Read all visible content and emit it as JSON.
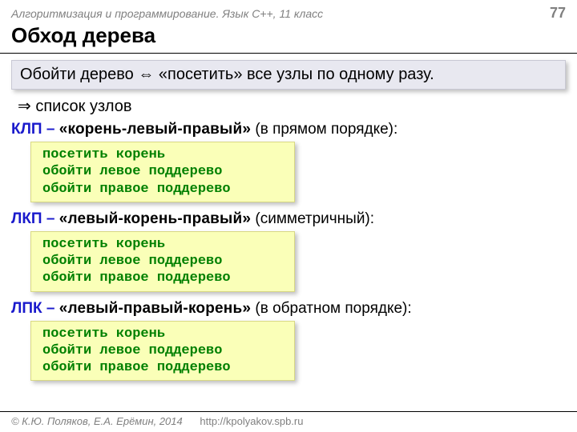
{
  "header": {
    "course": "Алгоритмизация и программирование. Язык C++, 11 класс",
    "page": "77"
  },
  "title": "Обход дерева",
  "definition": "Обойти дерево ⇔ «посетить» все узлы по одному разу.",
  "arrow_line": "⇒ список узлов",
  "sections": [
    {
      "abbr": "КЛП",
      "dash": " – ",
      "name": "«корень-левый-правый»",
      "suffix": " (в прямом порядке):",
      "code": [
        "посетить корень",
        "обойти левое поддерево",
        "обойти правое поддерево"
      ]
    },
    {
      "abbr": "ЛКП",
      "dash": " – ",
      "name": "«левый-корень-правый»",
      "suffix": " (симметричный):",
      "code": [
        "посетить корень",
        "обойти левое поддерево",
        "обойти правое поддерево"
      ]
    },
    {
      "abbr": "ЛПК",
      "dash": " – ",
      "name": "«левый-правый-корень»",
      "suffix": " (в обратном порядке):",
      "code": [
        "посетить корень",
        "обойти левое поддерево",
        "обойти правое поддерево"
      ]
    }
  ],
  "footer": {
    "copyright": "© К.Ю. Поляков, Е.А. Ерёмин, 2014",
    "url": "http://kpolyakov.spb.ru"
  }
}
